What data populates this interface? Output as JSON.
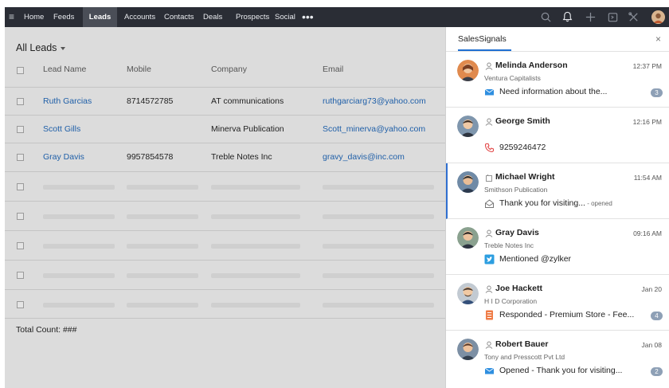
{
  "nav": {
    "items": [
      "Home",
      "Feeds",
      "Leads",
      "Accounts",
      "Contacts",
      "Deals",
      "Prospects",
      "Social"
    ],
    "active": "Leads",
    "more": "•••"
  },
  "leads": {
    "view_title": "All Leads",
    "columns": [
      "Lead Name",
      "Mobile",
      "Company",
      "Email"
    ],
    "rows": [
      {
        "name": "Ruth Garcias",
        "mobile": "8714572785",
        "company": "AT communications",
        "email": "ruthgarciarg73@yahoo.com"
      },
      {
        "name": "Scott Gills",
        "mobile": "",
        "company": "Minerva Publication",
        "email": "Scott_minerva@yahoo.com"
      },
      {
        "name": "Gray Davis",
        "mobile": "9957854578",
        "company": "Treble Notes Inc",
        "email": "gravy_davis@inc.com"
      }
    ],
    "total_label": "Total Count: ###"
  },
  "panel": {
    "title": "SalesSignals",
    "close": "×",
    "signals": [
      {
        "name": "Melinda Anderson",
        "time": "12:37 PM",
        "company": "Ventura Capitalists",
        "icon": "mail-icon",
        "message": "Need information about the...",
        "suffix": "",
        "badge": "3",
        "avatar_color": "#d98a4f"
      },
      {
        "name": "George Smith",
        "time": "12:16 PM",
        "company": "",
        "icon": "phone-icon",
        "message": "9259246472",
        "suffix": "",
        "badge": "",
        "avatar_color": "#7f96ad"
      },
      {
        "name": "Michael Wright",
        "time": "11:54 AM",
        "company": "Smithson Publication",
        "icon": "mail-opened-icon",
        "message": "Thank you for visiting...",
        "suffix": " - opened",
        "badge": "",
        "avatar_color": "#6f8aa6"
      },
      {
        "name": "Gray Davis",
        "time": "09:16 AM",
        "company": "Treble Notes Inc",
        "icon": "twitter-icon",
        "message": "Mentioned @zylker",
        "suffix": "",
        "badge": "",
        "avatar_color": "#8aa18f"
      },
      {
        "name": "Joe Hackett",
        "time": "Jan 20",
        "company": "H I D Corporation",
        "icon": "form-icon",
        "message": "Responded - Premium Store - Fee...",
        "suffix": "",
        "badge": "4",
        "avatar_color": "#a9b3bd"
      },
      {
        "name": "Robert Bauer",
        "time": "Jan 08",
        "company": "Tony and Presscott Pvt Ltd",
        "icon": "mail-icon",
        "message": "Opened - Thank you for visiting...",
        "suffix": "",
        "badge": "2",
        "avatar_color": "#7c8fa4"
      }
    ]
  },
  "colors": {
    "topbar": "#2a2d35",
    "link": "#1f5fa8",
    "accent": "#1f6fd1",
    "badge": "#8ea0b6"
  }
}
